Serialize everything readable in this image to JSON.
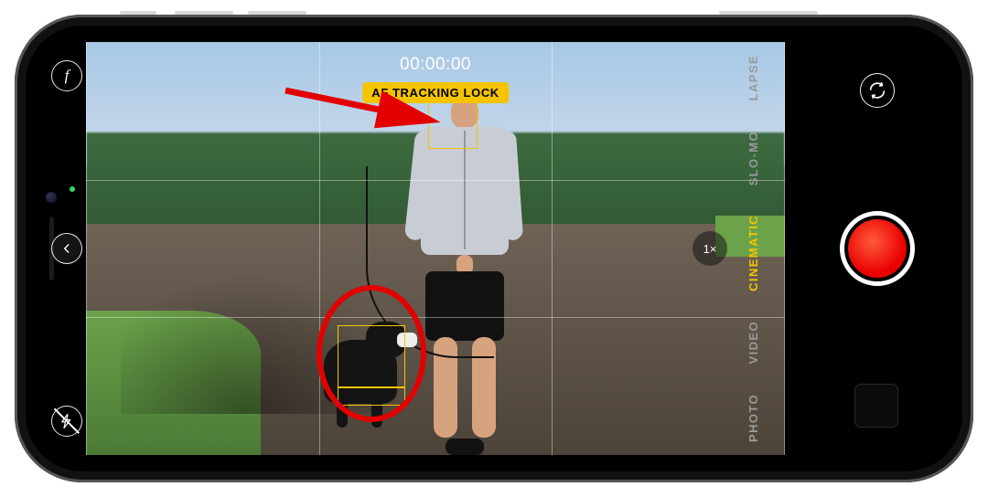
{
  "timecode": "00:00:00",
  "status": {
    "af_lock_label": "AF TRACKING LOCK"
  },
  "left_controls": {
    "depth_glyph": "f"
  },
  "modes": {
    "items": [
      {
        "label": "LAPSE"
      },
      {
        "label": "SLO-MO"
      },
      {
        "label": "CINEMATIC",
        "active": true
      },
      {
        "label": "VIDEO"
      },
      {
        "label": "PHOTO"
      }
    ]
  },
  "zoom": {
    "label": "1×"
  },
  "colors": {
    "accent": "#f4c400",
    "record": "#e80000",
    "annotation": "#e20000"
  }
}
